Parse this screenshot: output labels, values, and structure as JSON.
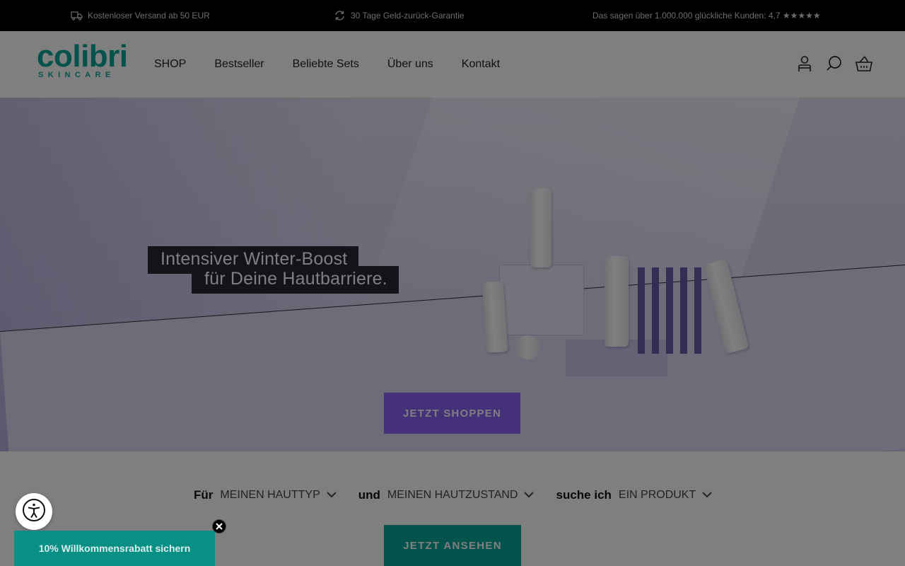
{
  "announcement": {
    "shipping": "Kostenloser Versand ab 50 EUR",
    "guarantee": "30 Tage Geld-zurück-Garantie",
    "reviews": "Das sagen über 1.000.000 glückliche Kunden: 4,7 ★★★★★"
  },
  "logo": {
    "name": "colibri",
    "tagline": "SKINCARE"
  },
  "nav": {
    "shop": "SHOP",
    "bestseller": "Bestseller",
    "sets": "Beliebte Sets",
    "about": "Über uns",
    "contact": "Kontakt"
  },
  "header_icons": [
    "account-icon",
    "search-icon",
    "cart-icon"
  ],
  "hero": {
    "headline_line1": "Intensiver Winter-Boost",
    "headline_line2": "für Deine Hautbarriere.",
    "cta": "JETZT SHOPPEN"
  },
  "finder": {
    "label_for": "Für",
    "skin_type": "MEINEN HAUTTYP",
    "label_and": "und",
    "skin_condition": "MEINEN HAUTZUSTAND",
    "label_search": "suche ich",
    "product": "EIN PRODUKT",
    "cta": "JETZT ANSEHEN"
  },
  "popup": {
    "discount": "10% Willkommensrabatt sichern"
  },
  "colors": {
    "brand_teal": "#0aa59a",
    "hero_cta": "#8a63f5",
    "finder_cta": "#08a89b",
    "topbar": "#000000"
  }
}
